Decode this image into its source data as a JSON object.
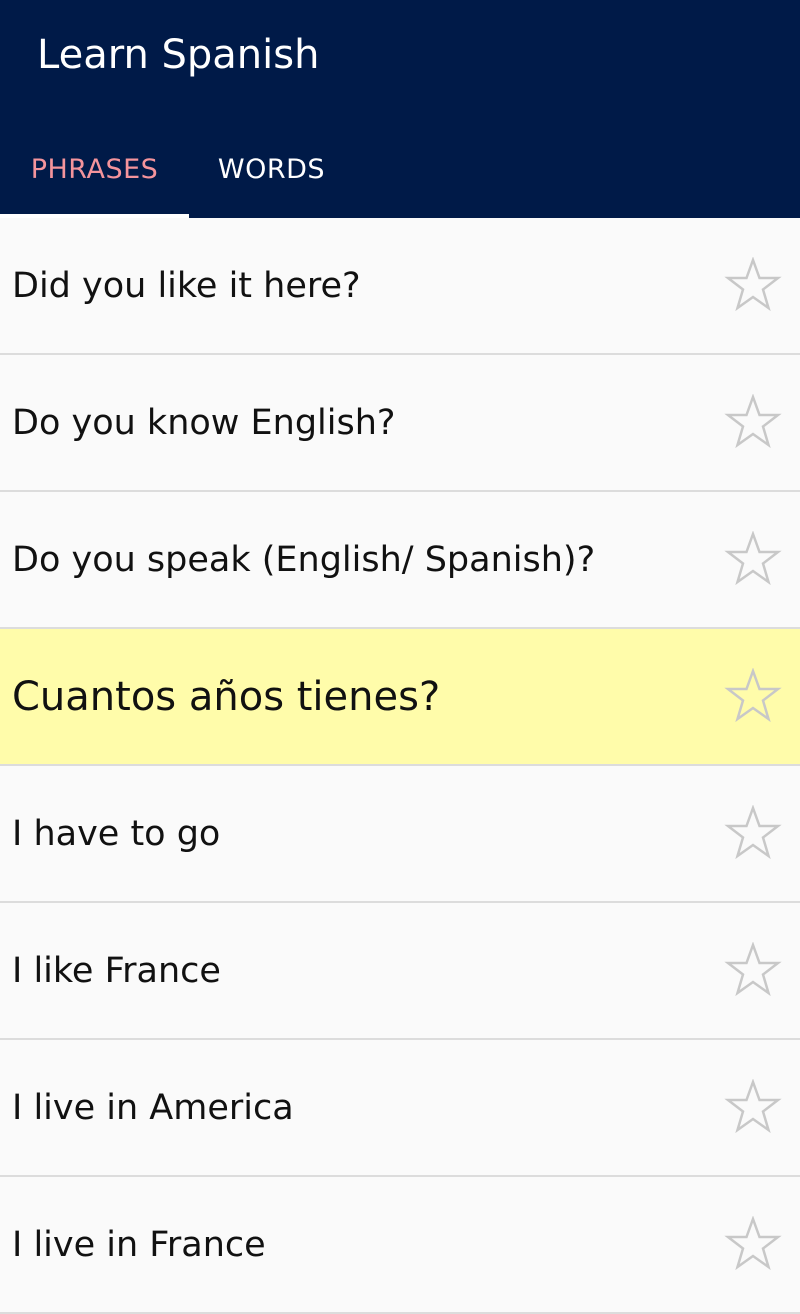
{
  "app": {
    "title": "Learn Spanish"
  },
  "tabs": [
    {
      "label": "PHRASES",
      "active": true
    },
    {
      "label": "WORDS",
      "active": false
    }
  ],
  "colors": {
    "appbar": "#001a48",
    "active_tab": "#f4949c",
    "highlight": "#fffcaa"
  },
  "phrases": [
    {
      "text": "Did you like it here?",
      "favorite": false
    },
    {
      "text": "Do you know English?",
      "favorite": false
    },
    {
      "text": "Do you speak (English/ Spanish)?",
      "favorite": false
    },
    {
      "text": "Cuantos años tienes?",
      "favorite": false,
      "highlighted": true
    },
    {
      "text": "I have to go",
      "favorite": false
    },
    {
      "text": "I like France",
      "favorite": false
    },
    {
      "text": "I live in America",
      "favorite": false
    },
    {
      "text": "I live in France",
      "favorite": false
    }
  ]
}
